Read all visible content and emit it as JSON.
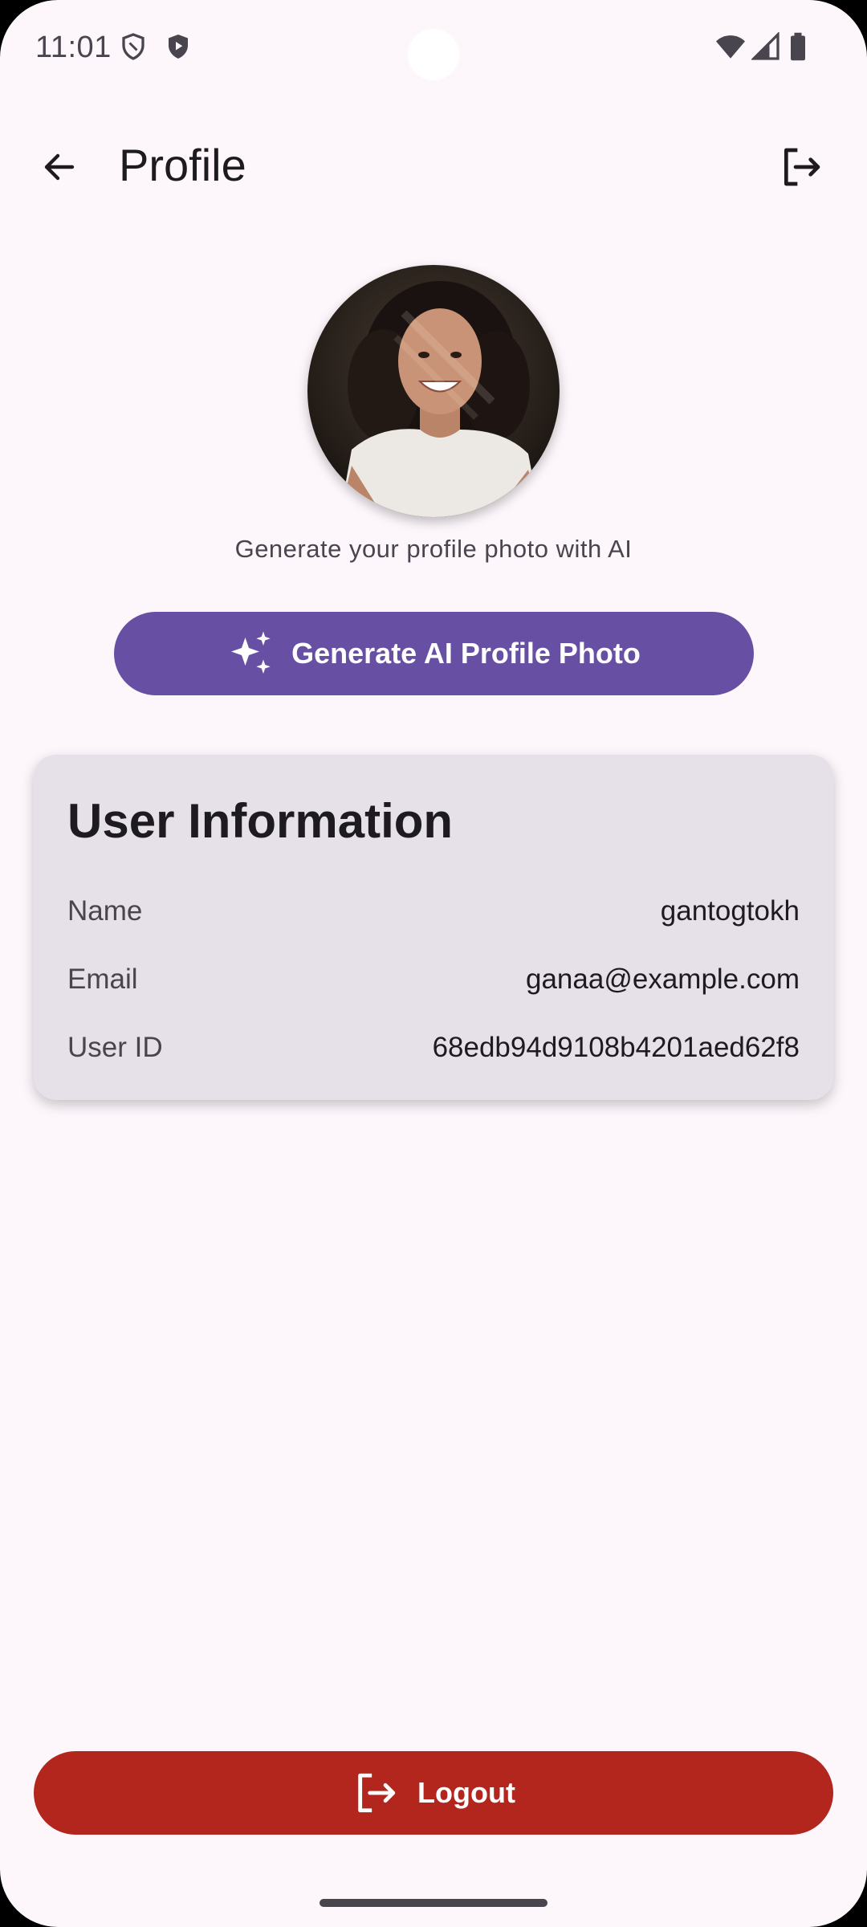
{
  "status_bar": {
    "time": "11:01",
    "left_icons": [
      "shield-outline-icon",
      "shield-play-icon"
    ],
    "right_icons": [
      "wifi-icon",
      "cell-signal-icon",
      "battery-icon"
    ]
  },
  "app_bar": {
    "title": "Profile",
    "back_icon": "arrow-back-icon",
    "action_icon": "logout-icon"
  },
  "profile": {
    "avatar": "profile-photo",
    "caption": "Generate your profile photo with AI",
    "generate_button": {
      "label": "Generate AI Profile Photo",
      "icon": "sparkle-icon"
    }
  },
  "user_info": {
    "title": "User Information",
    "rows": [
      {
        "label": "Name",
        "value": "gantogtokh"
      },
      {
        "label": "Email",
        "value": "ganaa@example.com"
      },
      {
        "label": "User ID",
        "value": "68edb94d9108b4201aed62f8"
      }
    ]
  },
  "logout_button": {
    "label": "Logout",
    "icon": "logout-icon"
  },
  "colors": {
    "background": "#fdf7fc",
    "primary": "#6750a4",
    "error": "#b3261e",
    "card": "#e6e0e8"
  }
}
